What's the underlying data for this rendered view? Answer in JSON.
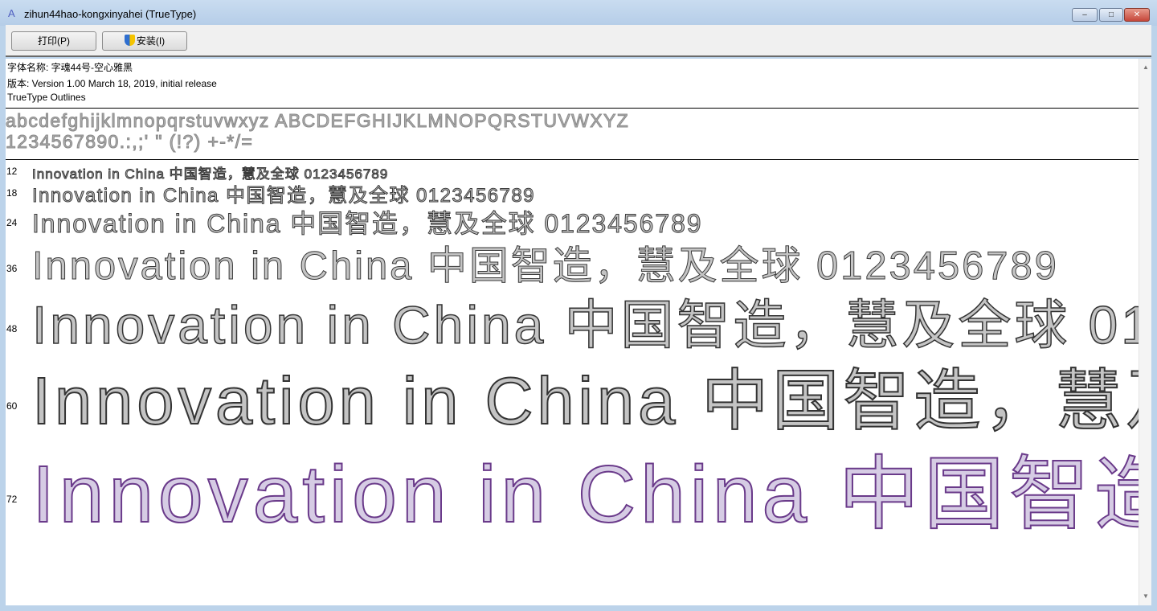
{
  "window": {
    "title": "zihun44hao-kongxinyahei (TrueType)",
    "minimize": "–",
    "maximize": "□",
    "close": "✕"
  },
  "toolbar": {
    "print_label": "打印(P)",
    "install_label": "安装(I)"
  },
  "info": {
    "font_name": "字体名称: 字魂44号-空心雅黑",
    "version": "版本: Version 1.00 March 18, 2019, initial release",
    "outlines": "TrueType Outlines"
  },
  "charset": {
    "line1": "abcdefghijklmnopqrstuvwxyz ABCDEFGHIJKLMNOPQRSTUVWXYZ",
    "line2": "1234567890.:,;' \" (!?) +-*/="
  },
  "sample_text": "Innovation in China 中国智造，慧及全球 0123456789",
  "samples": [
    {
      "size": "12"
    },
    {
      "size": "18"
    },
    {
      "size": "24"
    },
    {
      "size": "36"
    },
    {
      "size": "48"
    },
    {
      "size": "60"
    },
    {
      "size": "72"
    }
  ]
}
